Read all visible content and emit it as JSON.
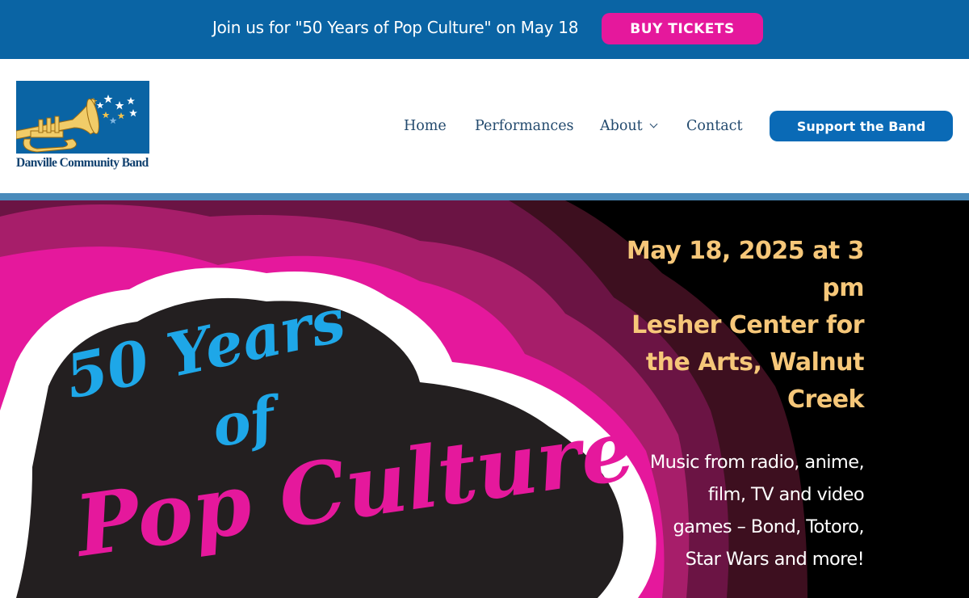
{
  "announcement": {
    "text": "Join us for \"50 Years of Pop Culture\" on May 18",
    "button_label": "BUY TICKETS"
  },
  "header": {
    "logo_text": "Danville Community Band",
    "nav": [
      {
        "label": "Home"
      },
      {
        "label": "Performances"
      },
      {
        "label": "About"
      },
      {
        "label": "Contact"
      }
    ],
    "cta_label": "Support the Band"
  },
  "hero": {
    "art_text": {
      "line1": "50 Years",
      "line2": "of",
      "line3": "Pop Culture"
    },
    "date_line1": "May 18, 2025 at 3",
    "date_line2": "pm",
    "venue_line1": "Lesher Center for",
    "venue_line2": "the Arts, Walnut",
    "venue_line3": "Creek",
    "desc_line1": "Music from radio, anime,",
    "desc_line2": "film, TV and video",
    "desc_line3": "games – Bond, Totoro,",
    "desc_line4": "Star Wars and more!"
  },
  "colors": {
    "brand_blue": "#0a64a4",
    "pink": "#e5189c",
    "gold": "#f6c779",
    "cyan": "#1ea7e8"
  },
  "icons": [
    "trumpet-icon",
    "star-icon",
    "chevron-down-icon"
  ]
}
